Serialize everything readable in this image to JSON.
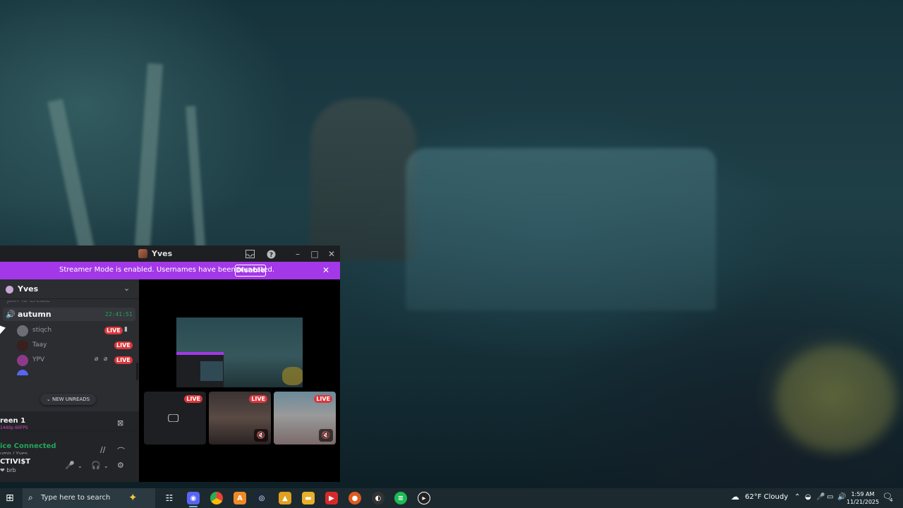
{
  "window": {
    "title": "Yves",
    "banner_message": "Streamer Mode is enabled. Usernames have been truncated.",
    "banner_disable": "Disable"
  },
  "server": {
    "name": "Yves",
    "cut_channel": "Join To Create"
  },
  "voice_channel": {
    "name": "autumn",
    "timer": "22:41:51"
  },
  "members": [
    {
      "name": "stiqch",
      "live": "LIVE"
    },
    {
      "name": "Taay",
      "live": "LIVE"
    },
    {
      "name": "YPV",
      "live": "LIVE"
    }
  ],
  "new_unreads": "NEW UNREADS",
  "stream_panel": {
    "title": "reen 1",
    "quality": "1440p 60FPS"
  },
  "voice_panel": {
    "status": "ice Connected",
    "location": "umn / Yves"
  },
  "user": {
    "name": "CTIVI$T",
    "status": "brb"
  },
  "stage": {
    "tiles": [
      {
        "live": "LIVE"
      },
      {
        "live": "LIVE"
      },
      {
        "live": "LIVE"
      }
    ]
  },
  "taskbar": {
    "search_placeholder": "Type here to search",
    "weather": "62°F  Cloudy",
    "time": "1:59 AM",
    "date": "11/21/2025",
    "notification_count": "4"
  }
}
